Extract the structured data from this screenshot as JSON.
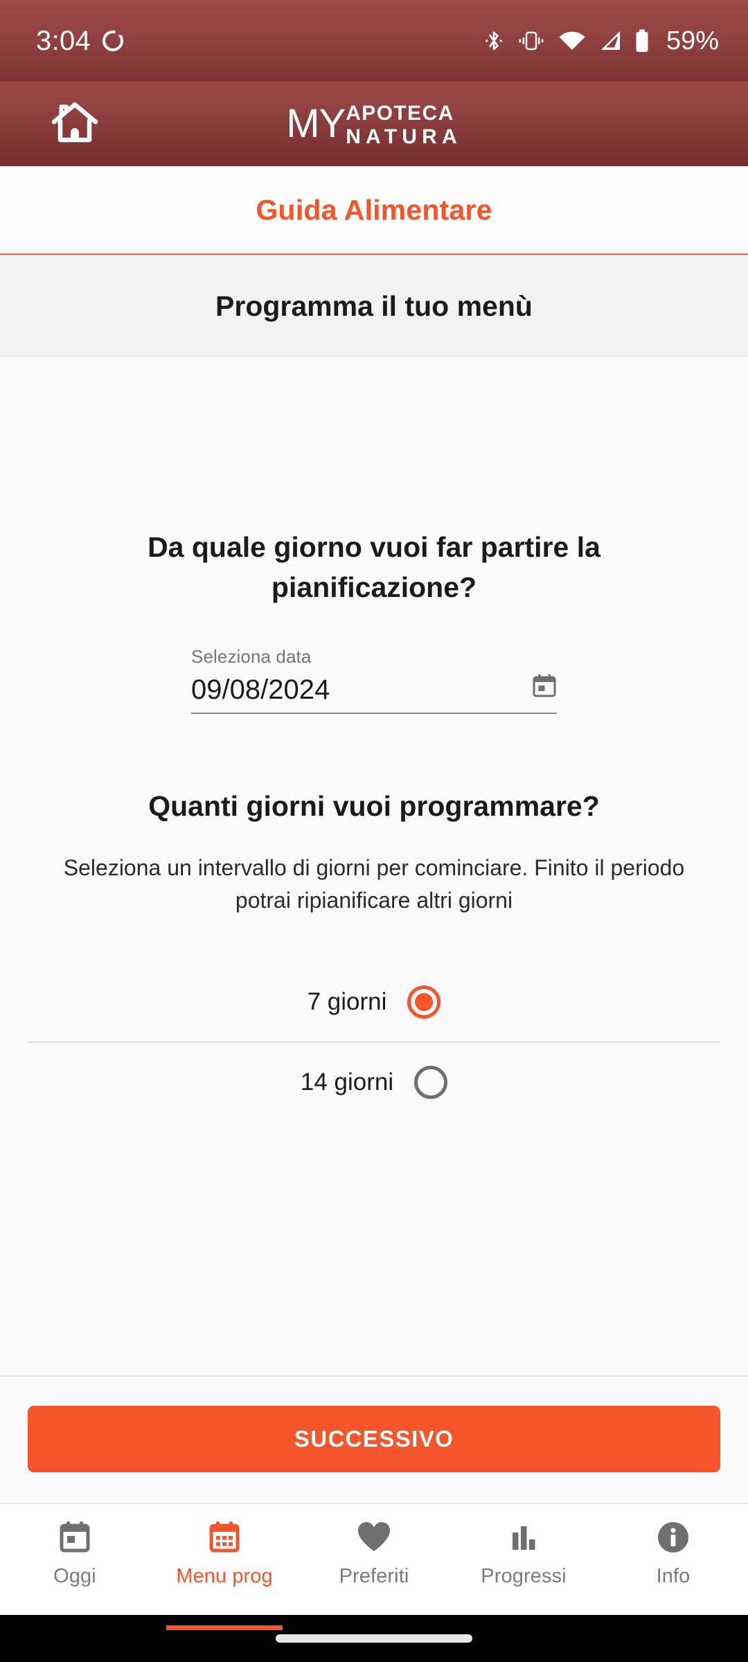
{
  "status_bar": {
    "time": "3:04",
    "refresh_icon": "rotate-icon",
    "icons": [
      "bluetooth-icon",
      "vibrate-icon",
      "wifi-icon",
      "cellular-signal-icon",
      "battery-icon"
    ],
    "battery_percent": "59%"
  },
  "app_bar": {
    "home_icon": "home-icon",
    "logo": {
      "my": "MY",
      "apoteca": "APOTECA",
      "natura": "NATURA"
    }
  },
  "guide": {
    "title": "Guida Alimentare",
    "accent_color": "#f4552a"
  },
  "subtitle": {
    "text": "Programma il tuo menù"
  },
  "main": {
    "question_1": "Da quale giorno vuoi far partire la pianificazione?",
    "date_field": {
      "label": "Seleziona data",
      "value": "09/08/2024",
      "icon": "calendar-icon"
    },
    "question_2": "Quanti giorni vuoi programmare?",
    "question_2_help": "Seleziona un intervallo di giorni per cominciare. Finito il periodo potrai ripianificare altri giorni",
    "options": [
      {
        "label": "7 giorni",
        "selected": true
      },
      {
        "label": "14 giorni",
        "selected": false
      }
    ]
  },
  "cta": {
    "label": "SUCCESSIVO",
    "color": "#f4552a"
  },
  "bottom_nav": {
    "items": [
      {
        "label": "Oggi",
        "icon": "calendar-today-icon",
        "active": false
      },
      {
        "label": "Menu prog",
        "icon": "calendar-grid-icon",
        "active": true
      },
      {
        "label": "Preferiti",
        "icon": "heart-icon",
        "active": false
      },
      {
        "label": "Progressi",
        "icon": "bar-chart-icon",
        "active": false
      },
      {
        "label": "Info",
        "icon": "info-circle-icon",
        "active": false
      }
    ]
  }
}
